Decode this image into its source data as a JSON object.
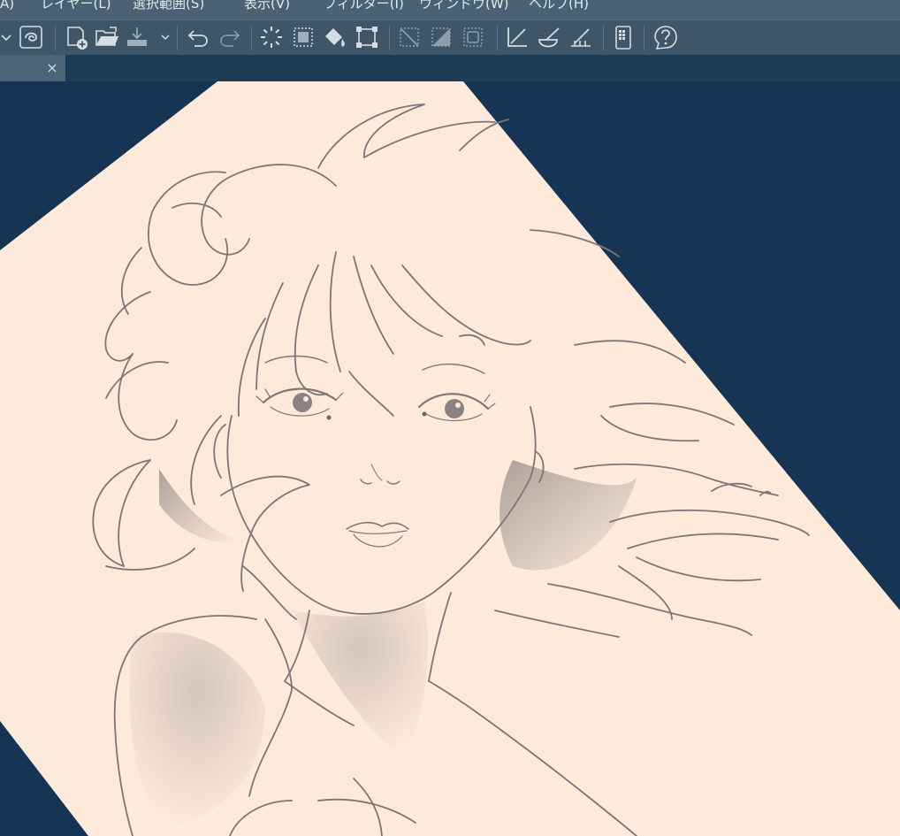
{
  "menu": {
    "items": [
      {
        "label": "A)"
      },
      {
        "label": "レイヤー(L)"
      },
      {
        "label": "選択範囲(S)"
      },
      {
        "label": "表示(V)"
      },
      {
        "label": "フィルター(I)"
      },
      {
        "label": "ウィンドウ(W)"
      },
      {
        "label": "ヘルプ(H)"
      }
    ]
  },
  "toolbar": {
    "icons": [
      "chevron-down-icon",
      "companion-mode-icon",
      "new-file-icon",
      "open-folder-icon",
      "export-icon",
      "undo-icon",
      "redo-icon",
      "clear-icon",
      "clear-outside-selection-icon",
      "fill-icon",
      "transform-icon",
      "deselect-icon",
      "invert-selection-icon",
      "show-selection-area-icon",
      "ruler-snap-icon",
      "special-ruler-snap-icon",
      "grid-snap-icon",
      "smartphone-icon",
      "help-icon"
    ]
  },
  "tab": {
    "close_glyph": "×"
  },
  "colors": {
    "background": "#163454",
    "paper": "#fdeadb",
    "toolbar": "#3e5667",
    "menubar": "#4a6273",
    "sketch_line": "#7e7676"
  }
}
